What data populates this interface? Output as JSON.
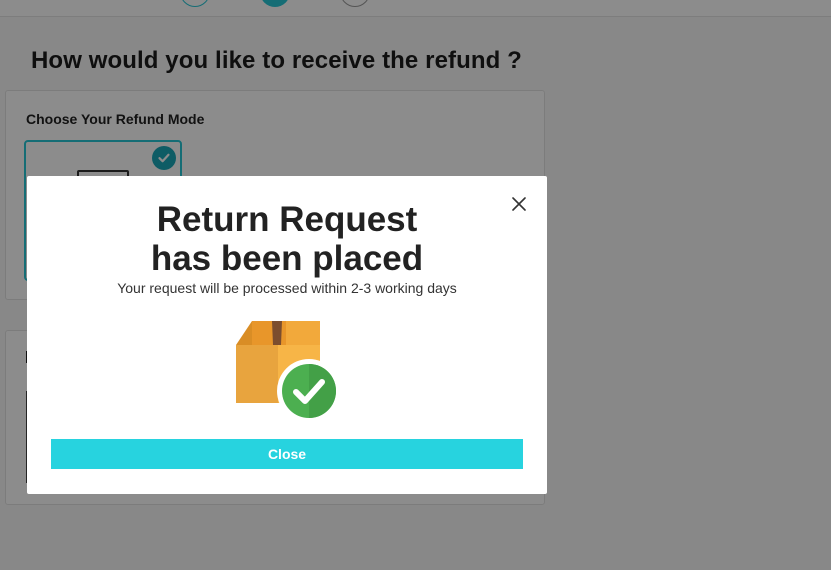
{
  "page": {
    "heading": "How would you like to receive the refund ?",
    "refund_mode_card": {
      "title": "Choose Your Refund Mode"
    }
  },
  "modal": {
    "title_line1": "Return Request",
    "title_line2": "has been placed",
    "subtitle": "Your request will be processed within 2-3 working days",
    "close_button_label": "Close"
  },
  "colors": {
    "accent": "#27c6d6",
    "button": "#27d3df",
    "success_green": "#4caf50",
    "box_orange": "#f5a623"
  },
  "icons": [
    "close-icon",
    "checkmark-icon",
    "package-box-icon",
    "success-check-icon"
  ]
}
